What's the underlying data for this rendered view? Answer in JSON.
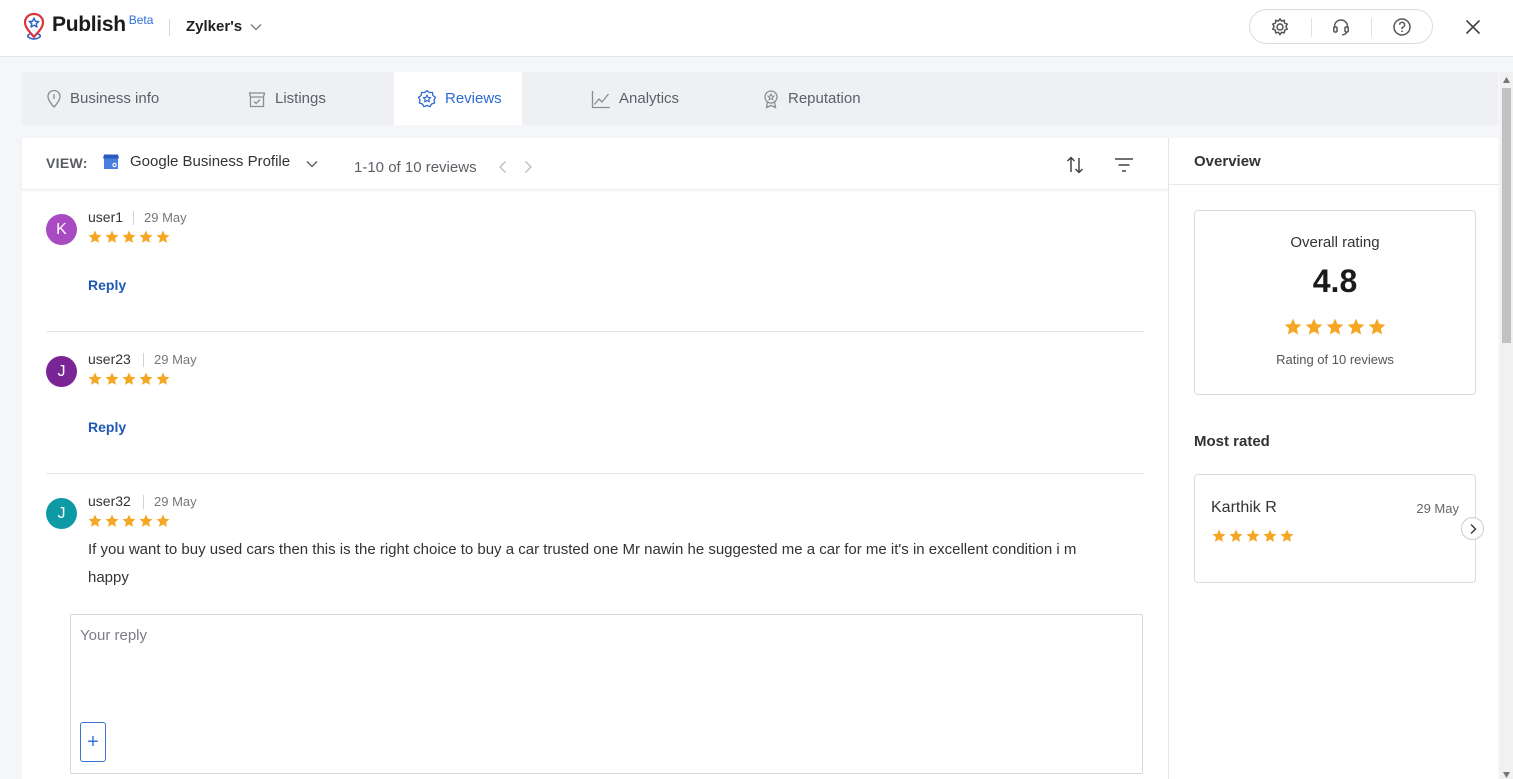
{
  "app": {
    "name": "Publish",
    "badge": "Beta",
    "org": "Zylker's"
  },
  "header": {
    "icons": [
      "settings-icon",
      "headset-icon",
      "help-icon"
    ],
    "close_icon": "close-icon"
  },
  "tabs": [
    {
      "label": "Business info",
      "icon": "location-pin-icon",
      "active": false
    },
    {
      "label": "Listings",
      "icon": "store-icon",
      "active": false
    },
    {
      "label": "Reviews",
      "icon": "star-badge-icon",
      "active": true
    },
    {
      "label": "Analytics",
      "icon": "line-chart-icon",
      "active": false
    },
    {
      "label": "Reputation",
      "icon": "award-icon",
      "active": false
    }
  ],
  "toolbar": {
    "view_label": "VIEW:",
    "source": "Google Business Profile",
    "pager": "1-10 of 10 reviews"
  },
  "reviews": [
    {
      "initial": "K",
      "user": "user1",
      "date": "29 May",
      "rating": 5,
      "text": "",
      "action": "Reply",
      "avatar_color": "#a84bc2"
    },
    {
      "initial": "J",
      "user": "user23",
      "date": "29 May",
      "rating": 5,
      "text": "",
      "action": "Reply",
      "avatar_color": "#7a2596"
    },
    {
      "initial": "J",
      "user": "user32",
      "date": "29 May",
      "rating": 5,
      "text": "If you want to buy used cars then this is the right choice to buy a car trusted one Mr nawin he suggested me a car for me it's in excellent condition i m happy",
      "avatar_color": "#0e9aa4"
    }
  ],
  "reply_box": {
    "placeholder": "Your reply",
    "add_label": "+"
  },
  "overview": {
    "title": "Overview",
    "overall_label": "Overall rating",
    "overall_value": "4.8",
    "overall_stars": 5,
    "rating_caption": "Rating of 10 reviews",
    "most_rated_title": "Most rated",
    "most_rated": {
      "name": "Karthik R",
      "date": "29 May",
      "rating": 5
    }
  },
  "colors": {
    "accent": "#2e6bd4",
    "star": "#f5a623",
    "reply_link": "#1f58b3"
  }
}
